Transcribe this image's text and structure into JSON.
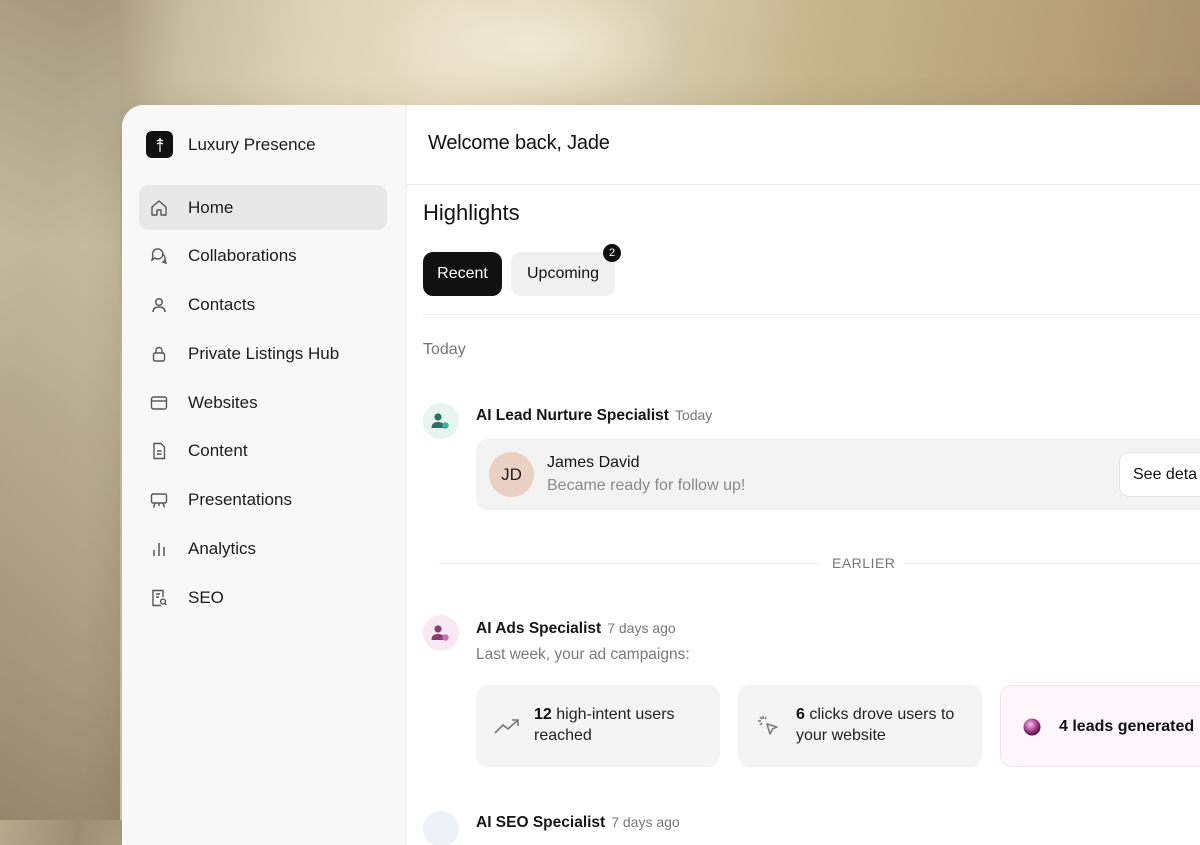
{
  "app": {
    "brand_name": "Luxury Presence"
  },
  "sidebar": {
    "items": [
      {
        "label": "Home",
        "icon": "home-icon",
        "active": true
      },
      {
        "label": "Collaborations",
        "icon": "chat-bubbles-icon"
      },
      {
        "label": "Contacts",
        "icon": "person-icon"
      },
      {
        "label": "Private Listings Hub",
        "icon": "lock-icon"
      },
      {
        "label": "Websites",
        "icon": "browser-window-icon"
      },
      {
        "label": "Content",
        "icon": "document-icon"
      },
      {
        "label": "Presentations",
        "icon": "presentation-board-icon"
      },
      {
        "label": "Analytics",
        "icon": "bar-chart-icon"
      },
      {
        "label": "SEO",
        "icon": "seo-document-search-icon"
      }
    ]
  },
  "header": {
    "welcome": "Welcome back, Jade"
  },
  "highlights": {
    "title": "Highlights",
    "tabs": [
      {
        "label": "Recent",
        "selected": true
      },
      {
        "label": "Upcoming",
        "badge": "2"
      }
    ],
    "today_label": "Today",
    "earlier_label": "EARLIER"
  },
  "feed": {
    "nurture": {
      "title": "AI Lead Nurture Specialist",
      "time": "Today",
      "lead_initials": "JD",
      "lead_name": "James David",
      "lead_status": "Became ready for follow up!",
      "action_label": "See deta"
    },
    "ads": {
      "title": "AI Ads Specialist",
      "time": "7 days ago",
      "subtitle": "Last week, your ad campaigns:",
      "stats": [
        {
          "number": "12",
          "text": " high-intent users reached",
          "icon": "trending-up-icon"
        },
        {
          "number": "6",
          "text": " clicks drove users to your website",
          "icon": "cursor-click-icon"
        },
        {
          "number": "",
          "text": "4 leads generated",
          "icon": "purple-orb-icon"
        }
      ]
    },
    "seo": {
      "title": "AI SEO Specialist",
      "time": "7 days ago"
    }
  },
  "colors": {
    "accent": "#111111",
    "lead_avatar": "#e9d2c5",
    "highlight_card": "#fdf6fb"
  }
}
